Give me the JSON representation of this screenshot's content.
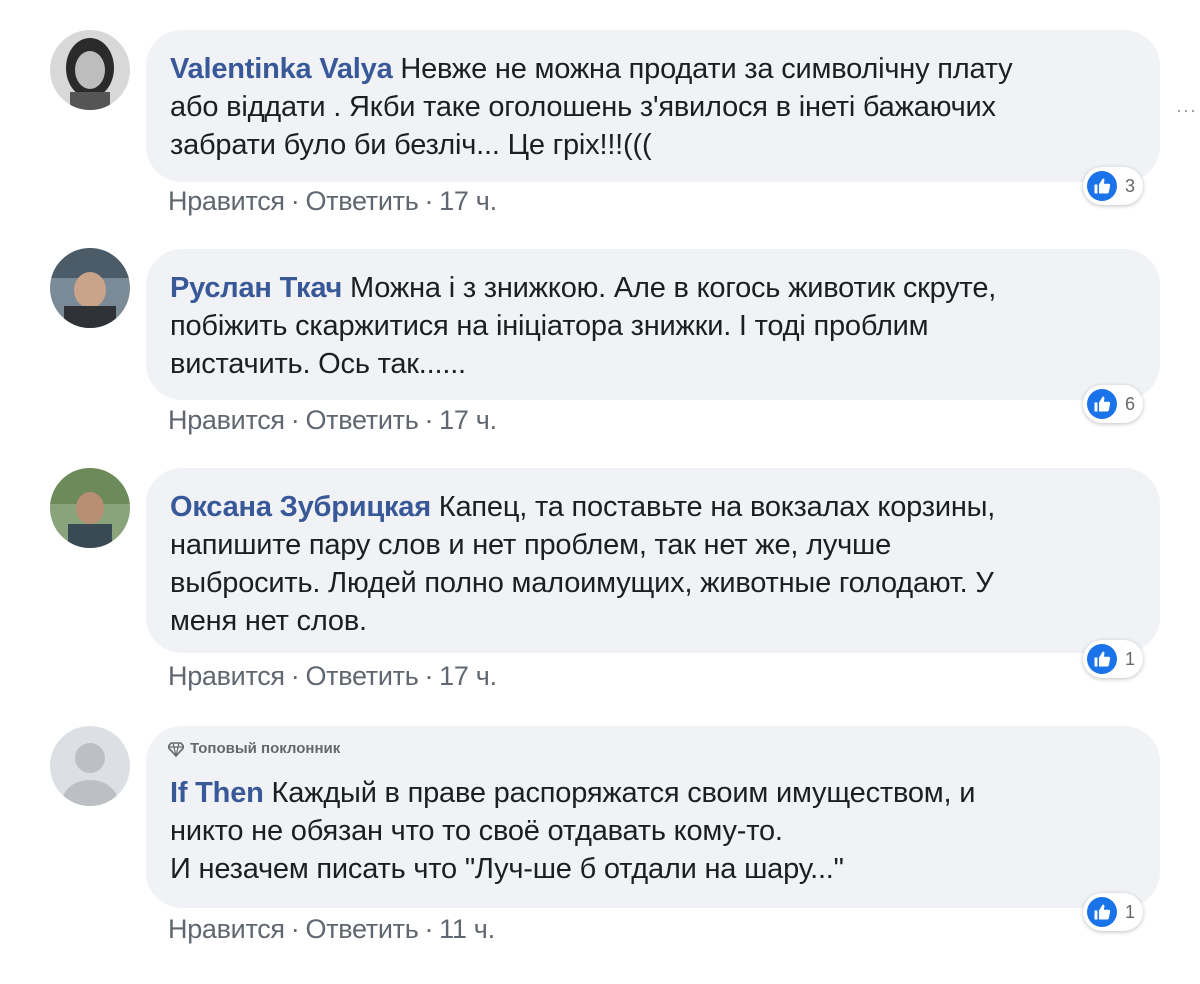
{
  "colors": {
    "author": "#385898",
    "bubble": "#f0f2f5",
    "like": "#1a73e8",
    "meta": "#606770"
  },
  "comments": [
    {
      "author": "Valentinka Valya",
      "lines": [
        " Невже не можна продати за символічну плату",
        "або віддати . Якби таке оголошень з'явилося в інеті бажаючих",
        "забрати було би безліч... Це гріх!!!((("
      ],
      "like_label": "Нравится",
      "reply_label": "Ответить",
      "time": "17 ч.",
      "reactions": "3",
      "avatar_icon": "user-photo"
    },
    {
      "author": "Руслан Ткач",
      "lines": [
        " Можна і з знижкою. Але в когось животик скруте,",
        "побіжить скаржитися на ініціатора знижки. І тоді проблим",
        "вистачить. Ось так......"
      ],
      "like_label": "Нравится",
      "reply_label": "Ответить",
      "time": "17 ч.",
      "reactions": "6",
      "avatar_icon": "user-photo"
    },
    {
      "author": "Оксана Зубрицкая",
      "lines": [
        " Капец, та поставьте на вокзалах корзины,",
        "напишите пару слов и нет проблем, так нет же, лучше",
        "выбросить. Людей полно малоимущих, животные голодают. У",
        "меня нет слов."
      ],
      "like_label": "Нравится",
      "reply_label": "Ответить",
      "time": "17 ч.",
      "reactions": "1",
      "avatar_icon": "user-photo"
    },
    {
      "badge": "Топовый поклонник",
      "badge_icon": "diamond-icon",
      "author": "If Then",
      "lines": [
        " Каждый в праве распоряжатся своим имуществом, и",
        "никто не обязан что то своё отдавать кому-то.",
        "И незачем писать что \"Луч-ше б отдали на шару...\""
      ],
      "like_label": "Нравится",
      "reply_label": "Ответить",
      "time": "11 ч.",
      "reactions": "1",
      "avatar_icon": "default-avatar"
    }
  ]
}
